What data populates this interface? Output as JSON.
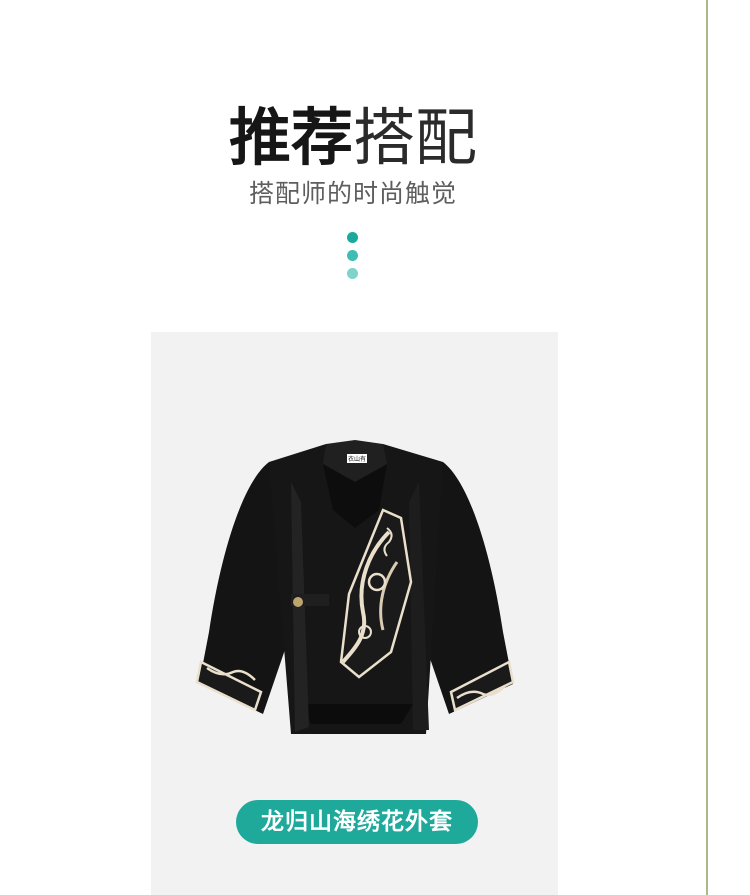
{
  "heading": {
    "bold_part": "推荐",
    "light_part": "搭配",
    "subtitle": "搭配师的时尚触觉"
  },
  "decor": {
    "dot_colors": [
      "#1aa99b",
      "#3ebdb0",
      "#7fd3cb"
    ],
    "edge_color": "#a9b98a"
  },
  "product": {
    "name": "龙归山海绣花外套",
    "accent_color": "#1ea99a",
    "tag_text": "衣山有"
  }
}
